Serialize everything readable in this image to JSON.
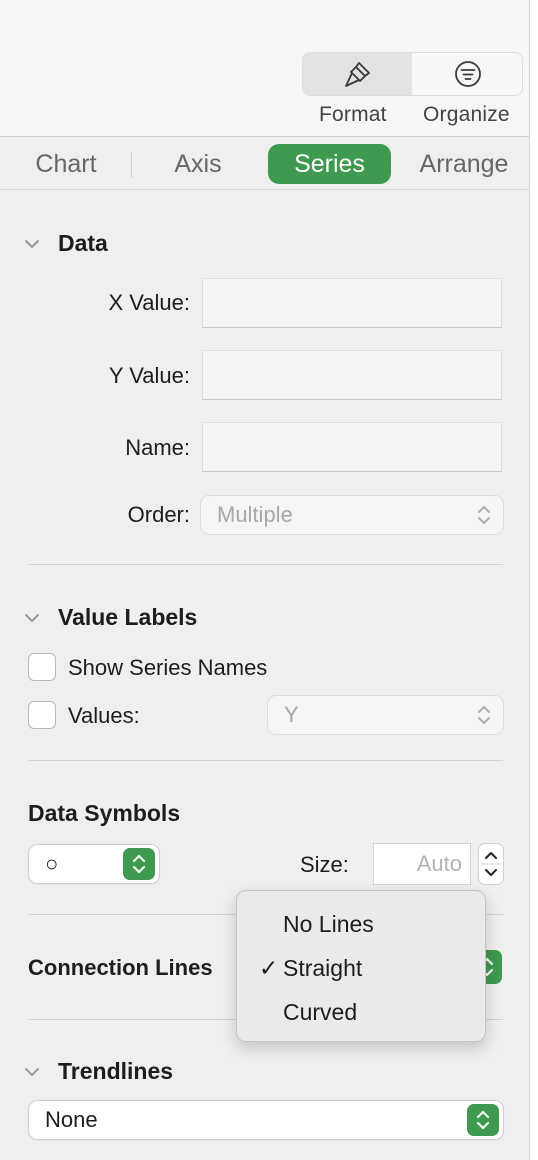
{
  "toolbar": {
    "format_label": "Format",
    "organize_label": "Organize",
    "format_icon": "paintbrush-icon",
    "organize_icon": "filter-lines-icon"
  },
  "tabs": [
    {
      "label": "Chart",
      "active": false
    },
    {
      "label": "Axis",
      "active": false
    },
    {
      "label": "Series",
      "active": true
    },
    {
      "label": "Arrange",
      "active": false
    }
  ],
  "data_section": {
    "title": "Data",
    "x_value_label": "X Value:",
    "x_value": "",
    "y_value_label": "Y Value:",
    "y_value": "",
    "name_label": "Name:",
    "name_value": "",
    "order_label": "Order:",
    "order_value": "Multiple"
  },
  "value_labels": {
    "title": "Value Labels",
    "show_series_names_label": "Show Series Names",
    "show_series_names_checked": false,
    "values_label": "Values:",
    "values_checked": false,
    "values_popup": "Y"
  },
  "data_symbols": {
    "title": "Data Symbols",
    "symbol_value": "○",
    "size_label": "Size:",
    "size_placeholder": "Auto"
  },
  "connection_lines": {
    "title": "Connection Lines",
    "menu_options": [
      "No Lines",
      "Straight",
      "Curved"
    ],
    "selected": "Straight"
  },
  "trendlines": {
    "title": "Trendlines",
    "value": "None"
  },
  "colors": {
    "accent_green": "#3e9a4e"
  }
}
